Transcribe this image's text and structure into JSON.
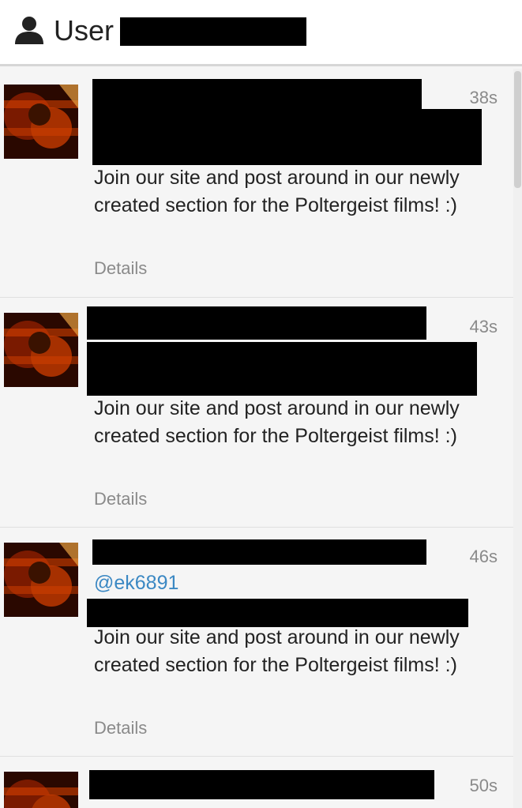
{
  "header": {
    "title": "User",
    "icon": "user-icon"
  },
  "tweets": [
    {
      "timestamp": "38s",
      "text": "Join our site and post around in our newly created section for the Poltergeist films! :)",
      "details_label": "Details"
    },
    {
      "timestamp": "43s",
      "text": "Join our site and post around in our newly created section for the Poltergeist films! :)",
      "details_label": "Details"
    },
    {
      "timestamp": "46s",
      "mention": "@ek6891",
      "text": "Join our site and post around in our newly created section for the Poltergeist films! :)",
      "details_label": "Details"
    },
    {
      "timestamp": "50s"
    }
  ],
  "colors": {
    "mention": "#3b88c3",
    "muted": "#8a8a8a",
    "text": "#222222"
  }
}
